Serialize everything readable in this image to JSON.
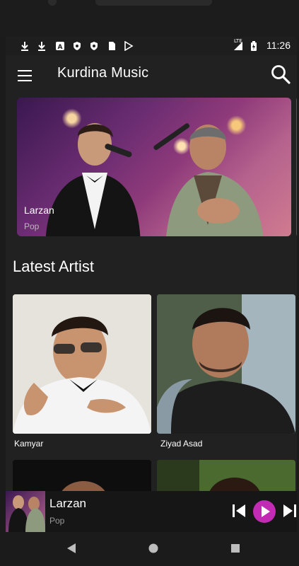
{
  "status_bar": {
    "time": "11:26",
    "network_label": "LTE",
    "icons": [
      "download-icon",
      "download-icon",
      "a-icon",
      "shield-icon",
      "shield-icon",
      "sd-card-icon",
      "play-store-icon",
      "signal-icon",
      "battery-icon"
    ]
  },
  "app_bar": {
    "title": "Kurdina Music",
    "menu_icon": "hamburger-menu-icon",
    "search_icon": "search-icon"
  },
  "featured": {
    "title": "Larzan",
    "genre": "Pop"
  },
  "latest_artist": {
    "heading": "Latest Artist",
    "artists": [
      {
        "name": "Kamyar"
      },
      {
        "name": "Ziyad Asad"
      }
    ]
  },
  "mini_player": {
    "title": "Larzan",
    "genre": "Pop",
    "controls": [
      "skip-previous-icon",
      "play-icon",
      "skip-next-icon"
    ],
    "accent_color": "#c22bb3"
  },
  "nav_bar": {
    "buttons": [
      "back-triangle-icon",
      "home-circle-icon",
      "recents-square-icon"
    ]
  },
  "colors": {
    "background": "#212121",
    "app_bar": "#212121",
    "accent": "#c22bb3"
  }
}
